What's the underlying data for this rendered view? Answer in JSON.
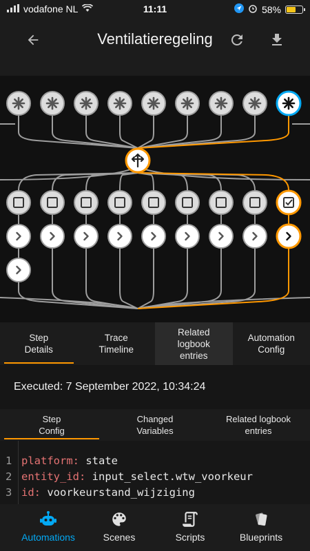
{
  "status_bar": {
    "carrier": "vodafone NL",
    "time": "11:11",
    "battery_percent": "58%",
    "battery_level": 0.58
  },
  "header": {
    "title": "Ventilatieregeling",
    "back_icon": "arrow-left-icon",
    "refresh_icon": "refresh-icon",
    "download_icon": "download-icon"
  },
  "graph": {
    "trigger_count": 9,
    "active_trigger_index": 8,
    "condition_count": 9,
    "active_condition_index": 8,
    "action_count": 9,
    "extra_action_rows": 1,
    "highlight_color": "#ff9800",
    "node_color": "#dddddd",
    "line_color": "#9e9e9e"
  },
  "main_tabs": [
    {
      "label": "Step\nDetails",
      "active": true
    },
    {
      "label": "Trace\nTimeline",
      "active": false
    },
    {
      "label": "Related\nlogbook\nentries",
      "active": false
    },
    {
      "label": "Automation\nConfig",
      "active": false
    }
  ],
  "executed_text": "Executed: 7 September 2022, 10:34:24",
  "detail_tabs": [
    {
      "label": "Step\nConfig",
      "active": true
    },
    {
      "label": "Changed\nVariables",
      "active": false
    },
    {
      "label": "Related logbook\nentries",
      "active": false
    }
  ],
  "code_lines": [
    {
      "num": "1",
      "key": "platform:",
      "value": " state"
    },
    {
      "num": "2",
      "key": "entity_id:",
      "value": " input_select.wtw_voorkeur"
    },
    {
      "num": "3",
      "key": "id:",
      "value": " voorkeurstand_wijziging"
    }
  ],
  "bottom_nav": [
    {
      "label": "Automations",
      "icon": "robot-icon",
      "active": true
    },
    {
      "label": "Scenes",
      "icon": "palette-icon",
      "active": false
    },
    {
      "label": "Scripts",
      "icon": "script-icon",
      "active": false
    },
    {
      "label": "Blueprints",
      "icon": "blueprint-icon",
      "active": false
    }
  ],
  "colors": {
    "accent": "#ff9800",
    "active_nav": "#03a9f4",
    "code_key": "#e57373"
  }
}
